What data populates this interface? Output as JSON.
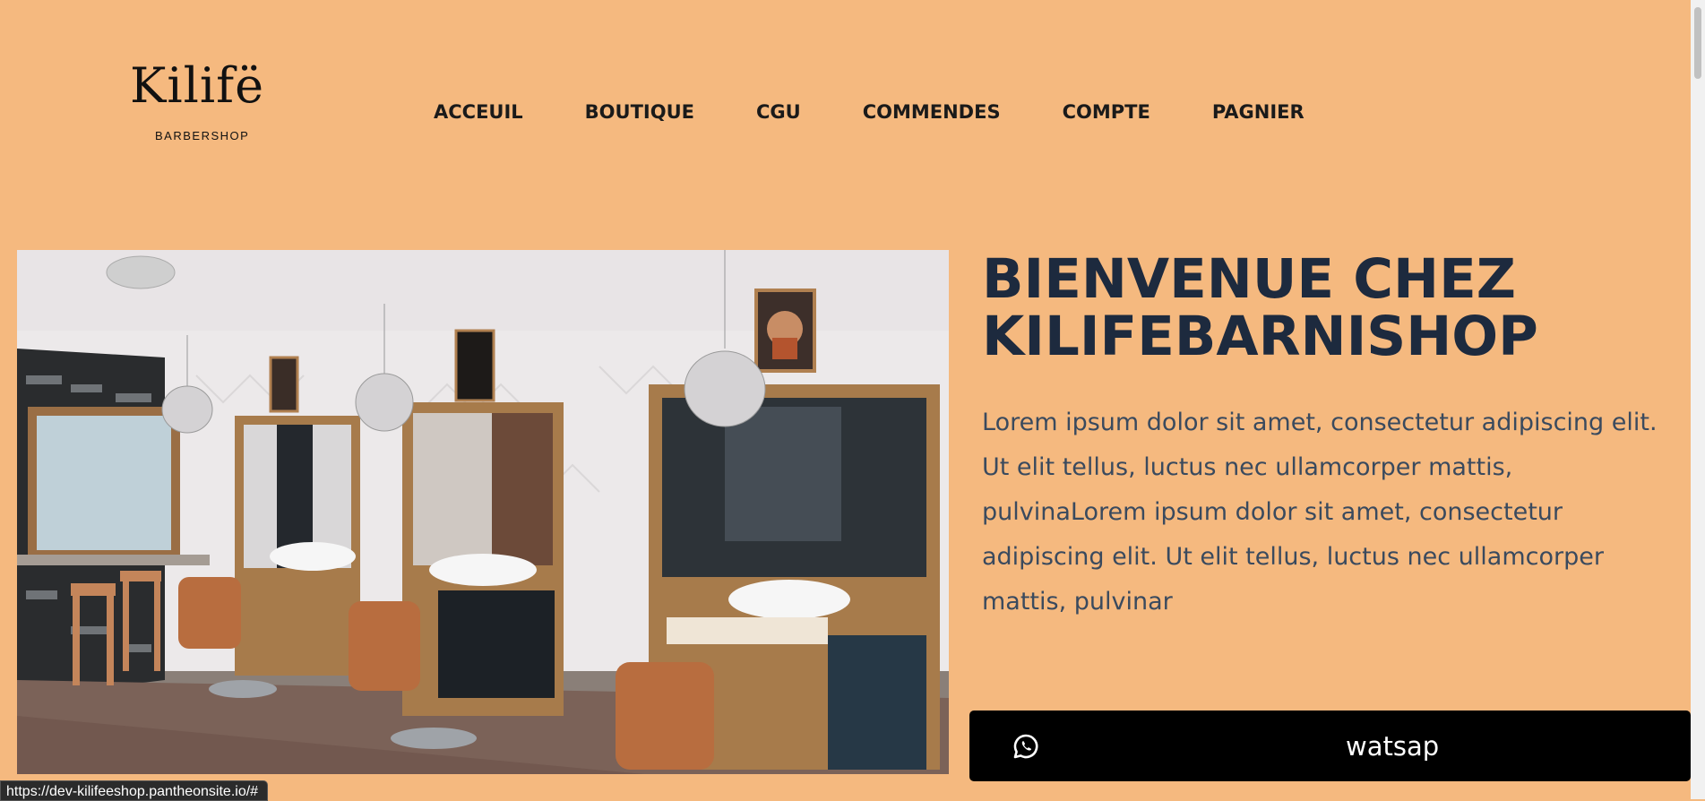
{
  "brand": {
    "name": "Kilifë",
    "tagline": "BARBERSHOP"
  },
  "nav": {
    "items": [
      "ACCEUIL",
      "BOUTIQUE",
      "CGU",
      "COMMENDES",
      "COMPTE",
      "PAGNIER"
    ]
  },
  "hero": {
    "title": "BIENVENUE CHEZ KILIFEBARNISHOP",
    "text": "Lorem ipsum dolor sit amet, consectetur adipiscing elit. Ut elit tellus, luctus nec ullamcorper mattis, pulvinaLorem ipsum dolor sit amet, consectetur adipiscing elit. Ut elit tellus, luctus nec ullamcorper mattis, pulvinar"
  },
  "cta": {
    "label": "watsap",
    "icon": "whatsapp-icon"
  },
  "status_bar": {
    "url": "https://dev-kilifeeshop.pantheonsite.io/#"
  },
  "colors": {
    "page_background": "#f5b97f",
    "heading": "#1d2a3e",
    "body_text": "#3a4a5e",
    "button_background": "#000000"
  }
}
